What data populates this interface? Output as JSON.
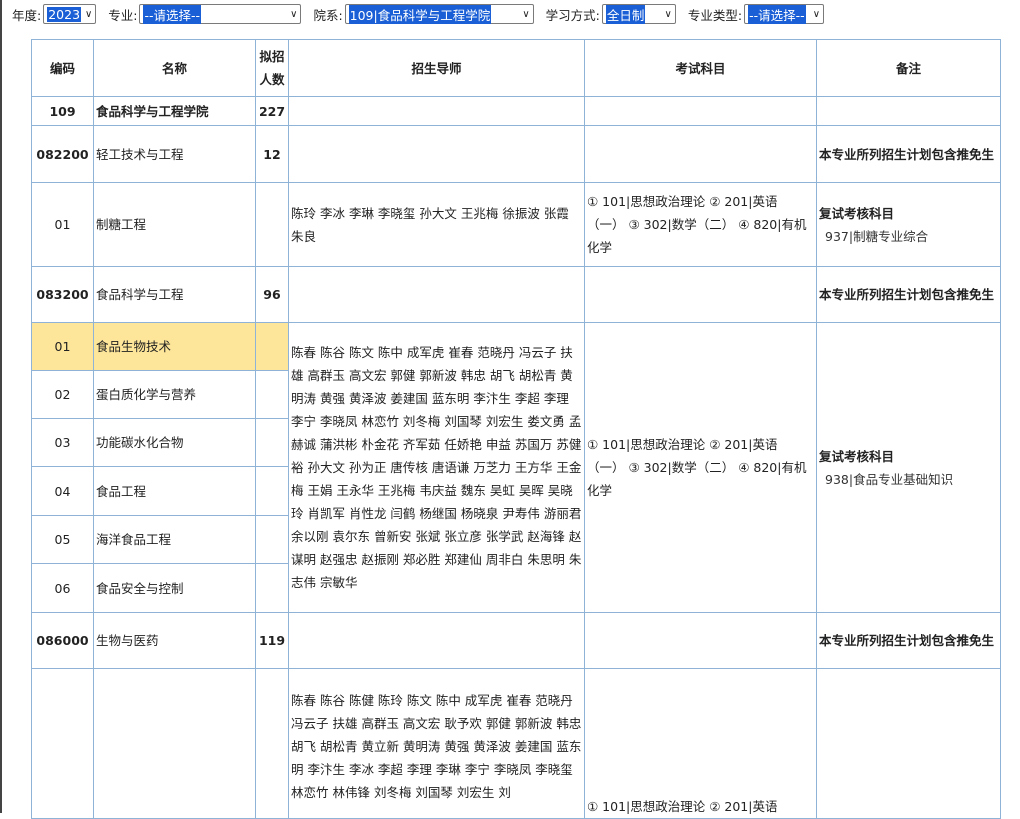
{
  "filters": {
    "year_label": "年度:",
    "year_value": "2023",
    "major_label": "专业:",
    "major_value": "--请选择--",
    "dept_label": "院系:",
    "dept_value": "109|食品科学与工程学院",
    "mode_label": "学习方式:",
    "mode_value": "全日制",
    "type_label": "专业类型:",
    "type_value": "--请选择--"
  },
  "headers": {
    "code": "编码",
    "name": "名称",
    "quota": "拟招人数",
    "tutors": "招生导师",
    "exam": "考试科目",
    "remark": "备注"
  },
  "rows": {
    "school": {
      "code": "109",
      "name": "食品科学与工程学院",
      "quota": "227"
    },
    "m1": {
      "code": "082200",
      "name": "轻工技术与工程",
      "quota": "12",
      "remark": "本专业所列招生计划包含推免生"
    },
    "m1d1": {
      "code": "01",
      "name": "制糖工程",
      "tutors": "陈玲 李冰 李琳 李晓玺 孙大文 王兆梅 徐振波 张霞 朱良",
      "exam": "① 101|思想政治理论 ② 201|英语（一） ③ 302|数学（二） ④ 820|有机化学",
      "retest_title": "复试考核科目",
      "retest_subject": "937|制糖专业综合"
    },
    "m2": {
      "code": "083200",
      "name": "食品科学与工程",
      "quota": "96",
      "remark": "本专业所列招生计划包含推免生"
    },
    "m2_directions": [
      {
        "code": "01",
        "name": "食品生物技术"
      },
      {
        "code": "02",
        "name": "蛋白质化学与营养"
      },
      {
        "code": "03",
        "name": "功能碳水化合物"
      },
      {
        "code": "04",
        "name": "食品工程"
      },
      {
        "code": "05",
        "name": "海洋食品工程"
      },
      {
        "code": "06",
        "name": "食品安全与控制"
      }
    ],
    "m2_tutors": "陈春 陈谷 陈文 陈中 成军虎 崔春 范晓丹 冯云子 扶雄 高群玉 高文宏 郭健 郭新波 韩忠 胡飞 胡松青 黄明涛 黄强 黄泽波 姜建国 蓝东明 李汴生 李超 李理 李宁 李晓凤 林恋竹 刘冬梅 刘国琴 刘宏生 娄文勇 孟赫诚 蒲洪彬 朴金花 齐军茹 任娇艳 申益 苏国万 苏健裕 孙大文 孙为正 唐传核 唐语谦 万芝力 王方华 王金梅 王娟 王永华 王兆梅 韦庆益 魏东 吴虹 吴晖 吴晓玲 肖凯军 肖性龙 闫鹤 杨继国 杨晓泉 尹寿伟 游丽君 余以刚 袁尔东 曾新安 张斌 张立彦 张学武 赵海锋 赵谋明 赵强忠 赵振刚 郑必胜 郑建仙 周非白 朱思明 朱志伟 宗敏华",
    "m2_exam": "① 101|思想政治理论 ② 201|英语（一） ③ 302|数学（二） ④ 820|有机化学",
    "m2_retest_title": "复试考核科目",
    "m2_retest_subject": "938|食品专业基础知识",
    "m3": {
      "code": "086000",
      "name": "生物与医药",
      "quota": "119",
      "remark": "本专业所列招生计划包含推免生"
    },
    "m3_tutors": "陈春 陈谷 陈健 陈玲 陈文 陈中 成军虎 崔春 范晓丹 冯云子 扶雄 高群玉 高文宏 耿予欢 郭健 郭新波 韩忠 胡飞 胡松青 黄立新 黄明涛 黄强 黄泽波 姜建国 蓝东明 李汴生 李冰 李超 李理 李琳 李宁 李晓凤 李晓玺 林恋竹 林伟锋 刘冬梅 刘国琴 刘宏生 刘",
    "m3_exam": "① 101|思想政治理论 ② 201|英语"
  }
}
